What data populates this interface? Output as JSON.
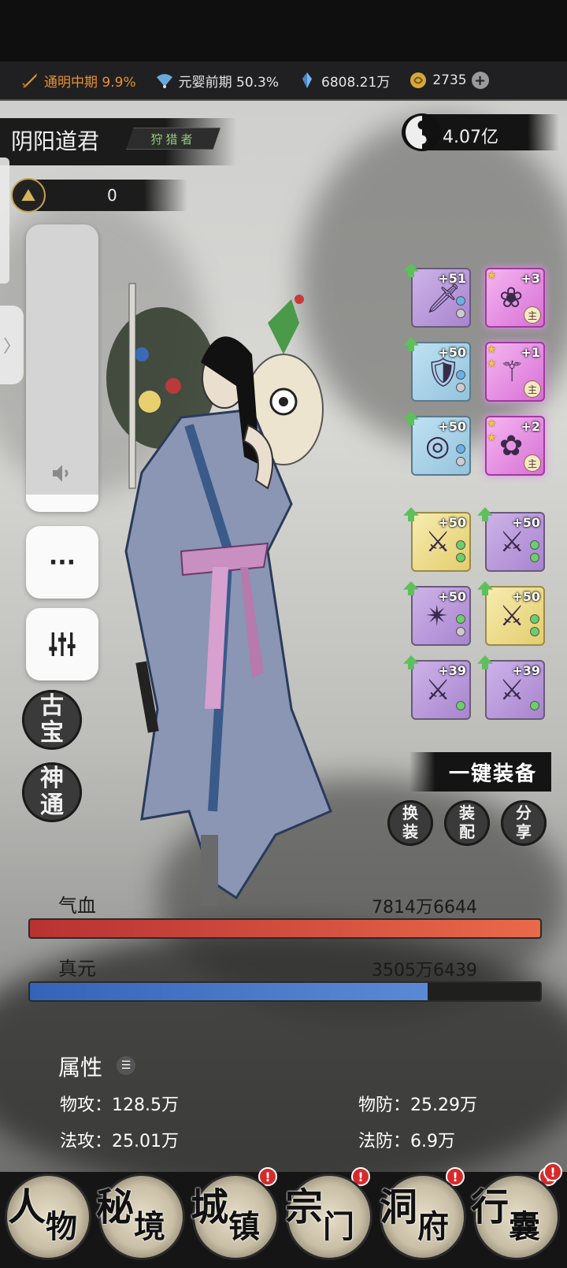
{
  "resources": {
    "cultivation": "通明中期 9.9%",
    "realm": "元婴前期 50.3%",
    "spirit_stones": "6808.21万",
    "currency": "2735"
  },
  "player": {
    "name": "阴阳道君",
    "title": "狩猎者",
    "power": "4.07亿",
    "counter": "0"
  },
  "volume_level_percent": 6,
  "side_buttons": {
    "more": "···",
    "treasure_top": "古",
    "treasure_bottom": "宝",
    "ability_top": "神",
    "ability_bottom": "通"
  },
  "equipment": {
    "left_column": [
      {
        "level": "+51",
        "type": "dagger",
        "rarity": "purple"
      },
      {
        "level": "+50",
        "type": "armor",
        "rarity": "blue"
      },
      {
        "level": "+50",
        "type": "rings",
        "rarity": "blue"
      }
    ],
    "right_column": [
      {
        "level": "+3",
        "main": "主",
        "rarity": "pink"
      },
      {
        "level": "+1",
        "main": "主",
        "rarity": "pink"
      },
      {
        "level": "+2",
        "main": "主",
        "rarity": "pink"
      }
    ],
    "grid": [
      {
        "level": "+50",
        "rarity": "yellow"
      },
      {
        "level": "+50",
        "rarity": "purple"
      },
      {
        "level": "+50",
        "rarity": "purple"
      },
      {
        "level": "+50",
        "rarity": "yellow"
      },
      {
        "level": "+39",
        "rarity": "purple"
      },
      {
        "level": "+39",
        "rarity": "purple"
      }
    ]
  },
  "actions": {
    "equip_all": "一键装备",
    "change_outfit_top": "换",
    "change_outfit_bottom": "装",
    "match_top": "装",
    "match_bottom": "配",
    "share_top": "分",
    "share_bottom": "享"
  },
  "stats": {
    "hp_label": "气血",
    "hp_value": "7814万6644",
    "hp_fill": 1.0,
    "mp_label": "真元",
    "mp_value": "3505万6439",
    "mp_fill": 0.78
  },
  "attributes": {
    "title": "属性",
    "phys_atk": "物攻：128.5万",
    "phys_def": "物防：25.29万",
    "mag_atk": "法攻：25.01万",
    "mag_def": "法防：6.9万"
  },
  "nav": [
    {
      "a": "人",
      "b": "物",
      "badge": ""
    },
    {
      "a": "秘",
      "b": "境",
      "badge": "!"
    },
    {
      "a": "城",
      "b": "镇",
      "badge": "!"
    },
    {
      "a": "宗",
      "b": "门",
      "badge": "!"
    },
    {
      "a": "洞",
      "b": "府",
      "badge": "!"
    },
    {
      "a": "行",
      "b": "囊",
      "badge": "!"
    }
  ],
  "colors": {
    "cultivation_text": "#e8912f",
    "hp_bar": "#d04a3a",
    "mp_bar": "#4a78c8",
    "badge": "#d62a2a"
  },
  "icons": [
    "sword-icon",
    "fan-icon",
    "crystal-icon",
    "coin-icon",
    "plus-icon",
    "yinyang-icon",
    "speaker-icon",
    "sliders-icon",
    "list-icon"
  ]
}
